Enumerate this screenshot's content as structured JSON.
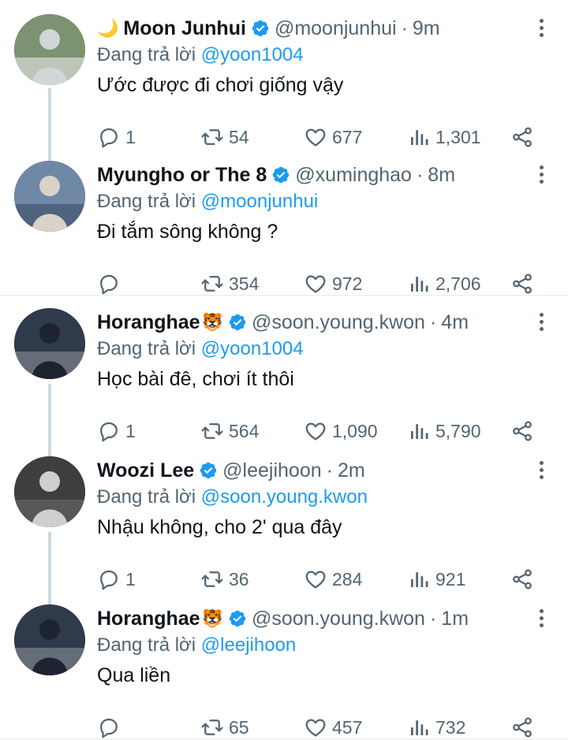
{
  "tweets": [
    {
      "name": "Moon Junhui",
      "emoji_before": "🌙",
      "emoji_after": "",
      "handle": "@moonjunhui",
      "time": "9m",
      "reply_label": "Đang trả lời",
      "reply_to": "@yoon1004",
      "text": "Ước được đi chơi giống vậy",
      "replies": "1",
      "retweets": "54",
      "likes": "677",
      "views": "1,301"
    },
    {
      "name": "Myungho or The 8",
      "emoji_before": "",
      "emoji_after": "",
      "handle": "@xuminghao",
      "time": "8m",
      "reply_label": "Đang trả lời",
      "reply_to": "@moonjunhui",
      "text": "Đi tắm sông không ?",
      "replies": "",
      "retweets": "354",
      "likes": "972",
      "views": "2,706"
    },
    {
      "name": "Horanghae",
      "emoji_before": "",
      "emoji_after": "🐯",
      "handle": "@soon.young.kwon",
      "time": "4m",
      "reply_label": "Đang trả lời",
      "reply_to": "@yoon1004",
      "text": "Học bài đê, chơi ít thôi",
      "replies": "1",
      "retweets": "564",
      "likes": "1,090",
      "views": "5,790"
    },
    {
      "name": "Woozi Lee",
      "emoji_before": "",
      "emoji_after": "",
      "handle": "@leejihoon",
      "time": "2m",
      "reply_label": "Đang trả lời",
      "reply_to": "@soon.young.kwon",
      "text": "Nhậu không, cho 2' qua đây",
      "replies": "1",
      "retweets": "36",
      "likes": "284",
      "views": "921"
    },
    {
      "name": "Horanghae",
      "emoji_before": "",
      "emoji_after": "🐯",
      "handle": "@soon.young.kwon",
      "time": "1m",
      "reply_label": "Đang trả lời",
      "reply_to": "@leejihoon",
      "text": "Qua liền",
      "replies": "",
      "retweets": "65",
      "likes": "457",
      "views": "732"
    }
  ],
  "colors": {
    "accent": "#1d9bf0",
    "secondary_text": "#536471",
    "primary_text": "#0f1419",
    "verified": "#1d9bf0",
    "thread_line": "#cfd9de"
  },
  "icons": {
    "verified": "verified-badge-icon",
    "reply": "reply-icon",
    "retweet": "retweet-icon",
    "like": "heart-icon",
    "views": "views-icon",
    "share": "share-icon",
    "more": "more-vertical-icon"
  }
}
